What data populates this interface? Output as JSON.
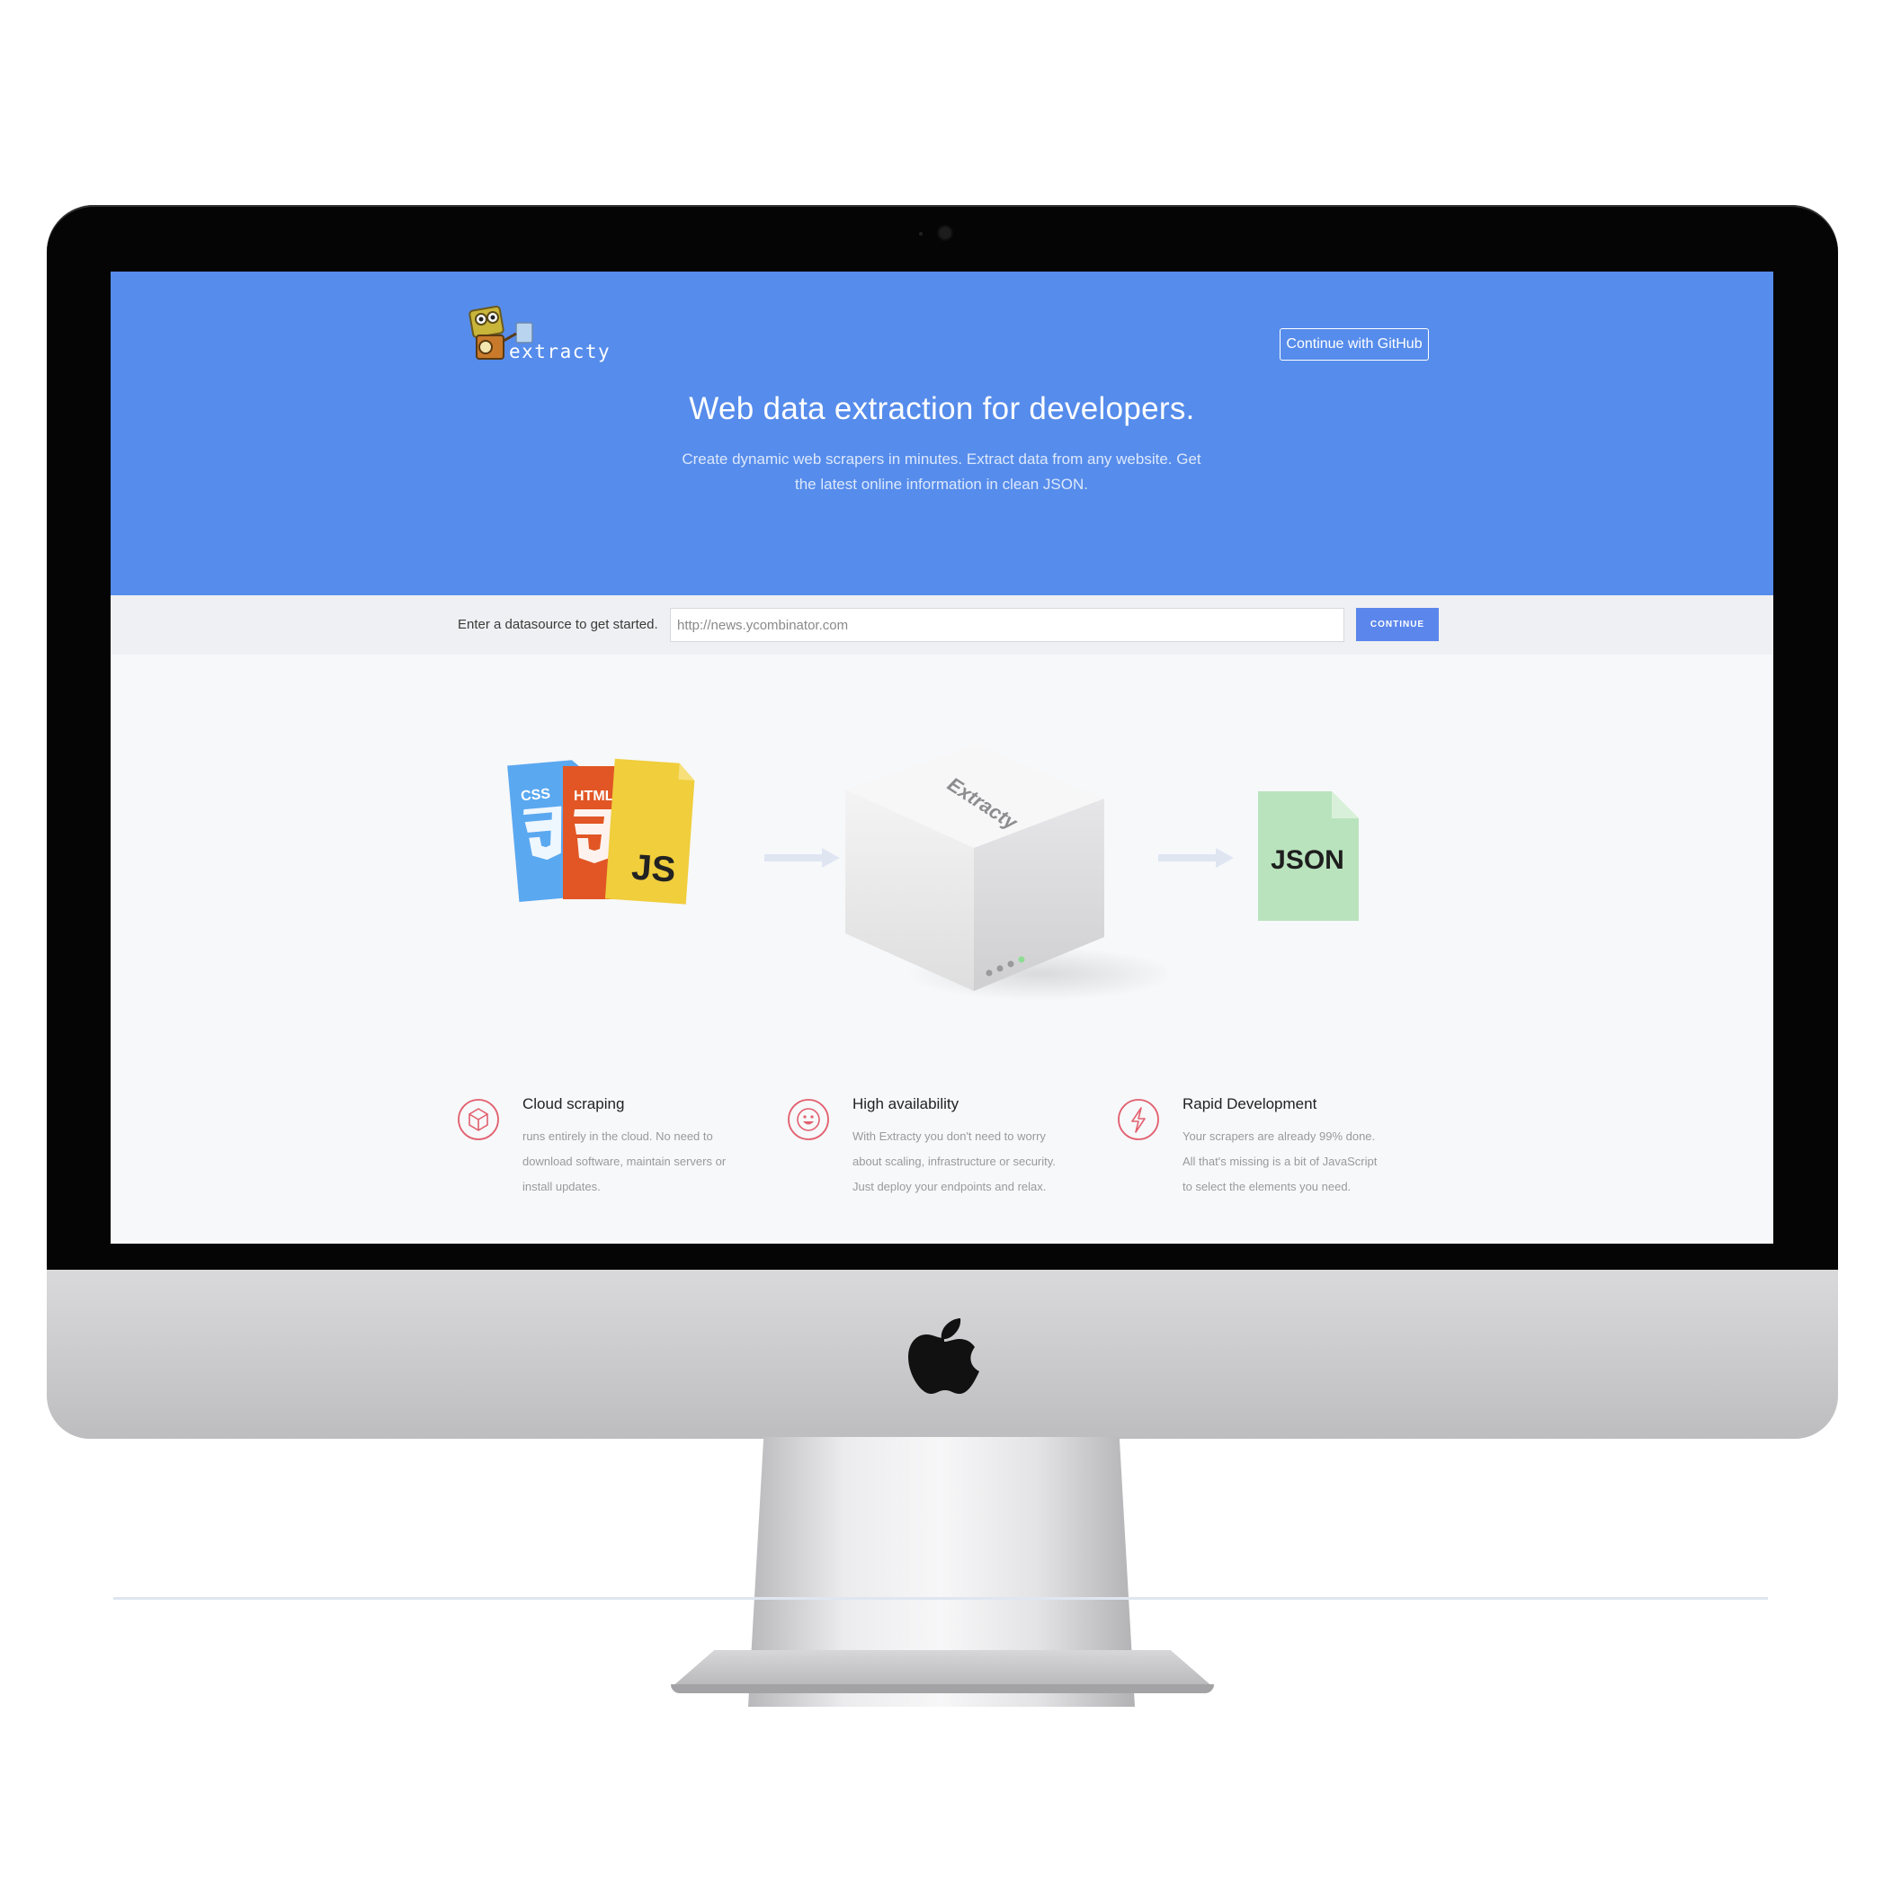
{
  "brand": {
    "name": "extracty"
  },
  "header": {
    "github_button": "Continue with GitHub"
  },
  "hero": {
    "title": "Web data extraction for developers.",
    "subtitle": "Create dynamic web scrapers in minutes. Extract data from any website. Get the latest online information in clean JSON."
  },
  "datasource": {
    "label": "Enter a datasource to get started.",
    "placeholder": "http://news.ycombinator.com",
    "button": "CONTINUE"
  },
  "diagram": {
    "inputs": [
      "CSS",
      "HTML",
      "JS"
    ],
    "engine": "Extracty",
    "output": "JSON"
  },
  "features": [
    {
      "icon": "cube-icon",
      "title": "Cloud scraping",
      "description": "runs entirely in the cloud. No need to download software, maintain servers or install updates."
    },
    {
      "icon": "smiley-icon",
      "title": "High availability",
      "description": "With Extracty you don't need to worry about scaling, infrastructure or security. Just deploy your endpoints and relax."
    },
    {
      "icon": "lightning-icon",
      "title": "Rapid Development",
      "description": "Your scrapers are already 99% done. All that's missing is a bit of JavaScript to select the elements you need."
    }
  ],
  "colors": {
    "hero_blue": "#568ceb",
    "button_blue": "#5b86ec",
    "css_blue": "#5aa8f0",
    "html_orange": "#e15624",
    "js_yellow": "#f0ce3c",
    "json_green": "#b9e3bd",
    "icon_red": "#e2606f"
  }
}
